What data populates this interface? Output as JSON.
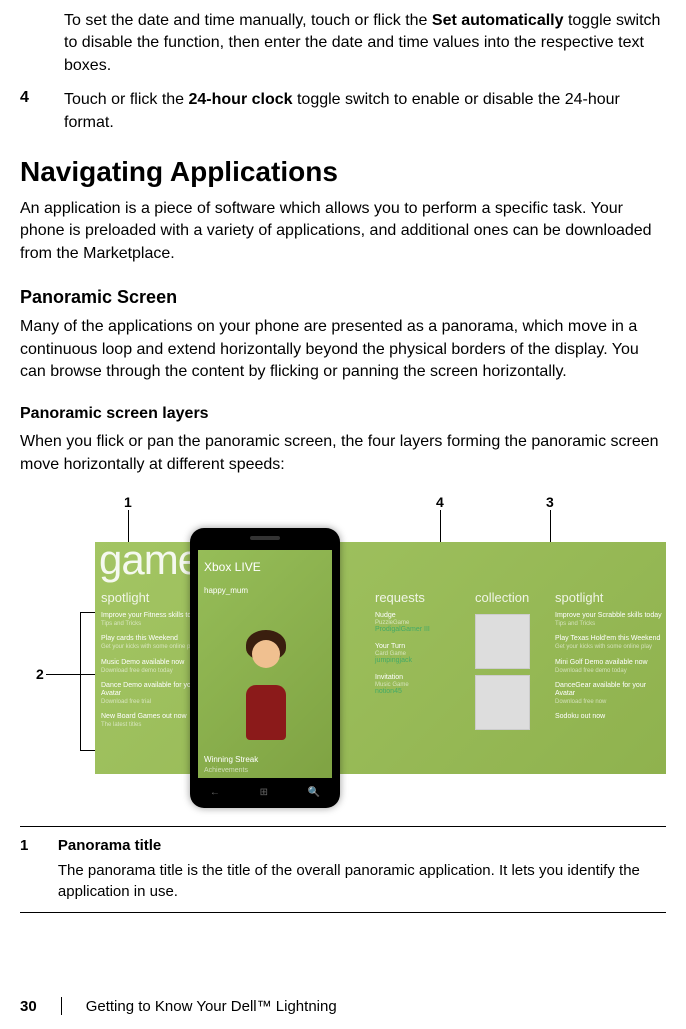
{
  "intro": {
    "manual_pre": "To set the date and time manually, touch or flick the ",
    "manual_bold": "Set automatically",
    "manual_post": " toggle switch to disable the function, then enter the date and time values into the respective text boxes."
  },
  "step4": {
    "num": "4",
    "pre": "Touch or flick the ",
    "bold": "24-hour clock",
    "post": " toggle switch to enable or disable the 24-hour format."
  },
  "h1": "Navigating Applications",
  "h1_para": "An application is a piece of software which allows you to perform a specific task. Your phone is preloaded with a variety of applications, and additional ones can be downloaded from the Marketplace.",
  "h2": "Panoramic Screen",
  "h2_para": "Many of the applications on your phone are presented as a panorama, which move in a continuous loop and extend horizontally beyond the physical borders of the display. You can browse through the content by flicking or panning the screen horizontally.",
  "h3": "Panoramic screen layers",
  "h3_para": "When you flick or pan the panoramic screen, the four layers forming the panoramic screen move horizontally at different speeds:",
  "callouts": {
    "c1": "1",
    "c2": "2",
    "c3": "3",
    "c4": "4"
  },
  "panorama": {
    "big_title": "games",
    "sections": {
      "spotlight": "spotlight",
      "xbox_live": "Xbox LIVE",
      "requests": "requests",
      "collection": "collection",
      "spotlight2": "spotlight"
    },
    "spotlight_items": [
      {
        "t": "Improve your Fitness skills today",
        "s": "Tips and Tricks"
      },
      {
        "t": "Play cards this Weekend",
        "s": "Get your kicks with some online play"
      },
      {
        "t": "Music Demo available now",
        "s": "Download free demo today"
      },
      {
        "t": "Dance Demo available for your Avatar",
        "s": "Download free trial"
      },
      {
        "t": "New Board Games out now",
        "s": "The latest titles"
      }
    ],
    "xbox": {
      "user": "happy_mum",
      "ach": "Winning Streak",
      "ach_sub": "Achievements"
    },
    "requests": [
      {
        "t": "Nudge",
        "s": "PuzzleGame",
        "g": "ProdigalGamer III"
      },
      {
        "t": "Your Turn",
        "s": "Card Game",
        "g": "jumpingjack"
      },
      {
        "t": "Invitation",
        "s": "Music Game",
        "g": "notion45"
      }
    ],
    "spotlight2_items": [
      {
        "t": "Improve your Scrabble skills today",
        "s": "Tips and Tricks"
      },
      {
        "t": "Play Texas Hold'em this Weekend",
        "s": "Get your kicks with some online play"
      },
      {
        "t": "Mini Golf Demo available now",
        "s": "Download free demo today"
      },
      {
        "t": "DanceGear available for your Avatar",
        "s": "Download free now"
      },
      {
        "t": "Sodoku out now",
        "s": ""
      }
    ]
  },
  "definition": {
    "num": "1",
    "title": "Panorama title",
    "desc": "The panorama title is the title of the overall panoramic application. It lets you identify the application in use."
  },
  "footer": {
    "page": "30",
    "chapter": "Getting to Know Your Dell™ Lightning"
  }
}
